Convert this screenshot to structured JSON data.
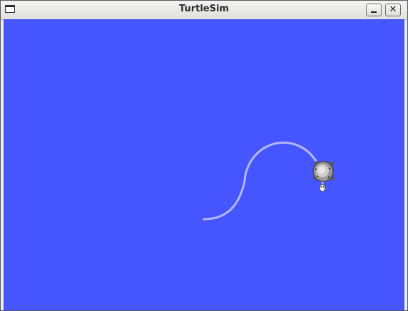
{
  "window": {
    "title": "TurtleSim"
  },
  "canvas": {
    "background_color": "#4556ff",
    "pen_color": "#b3b8ff"
  },
  "turtle": {
    "icon": "turtle-icon"
  }
}
